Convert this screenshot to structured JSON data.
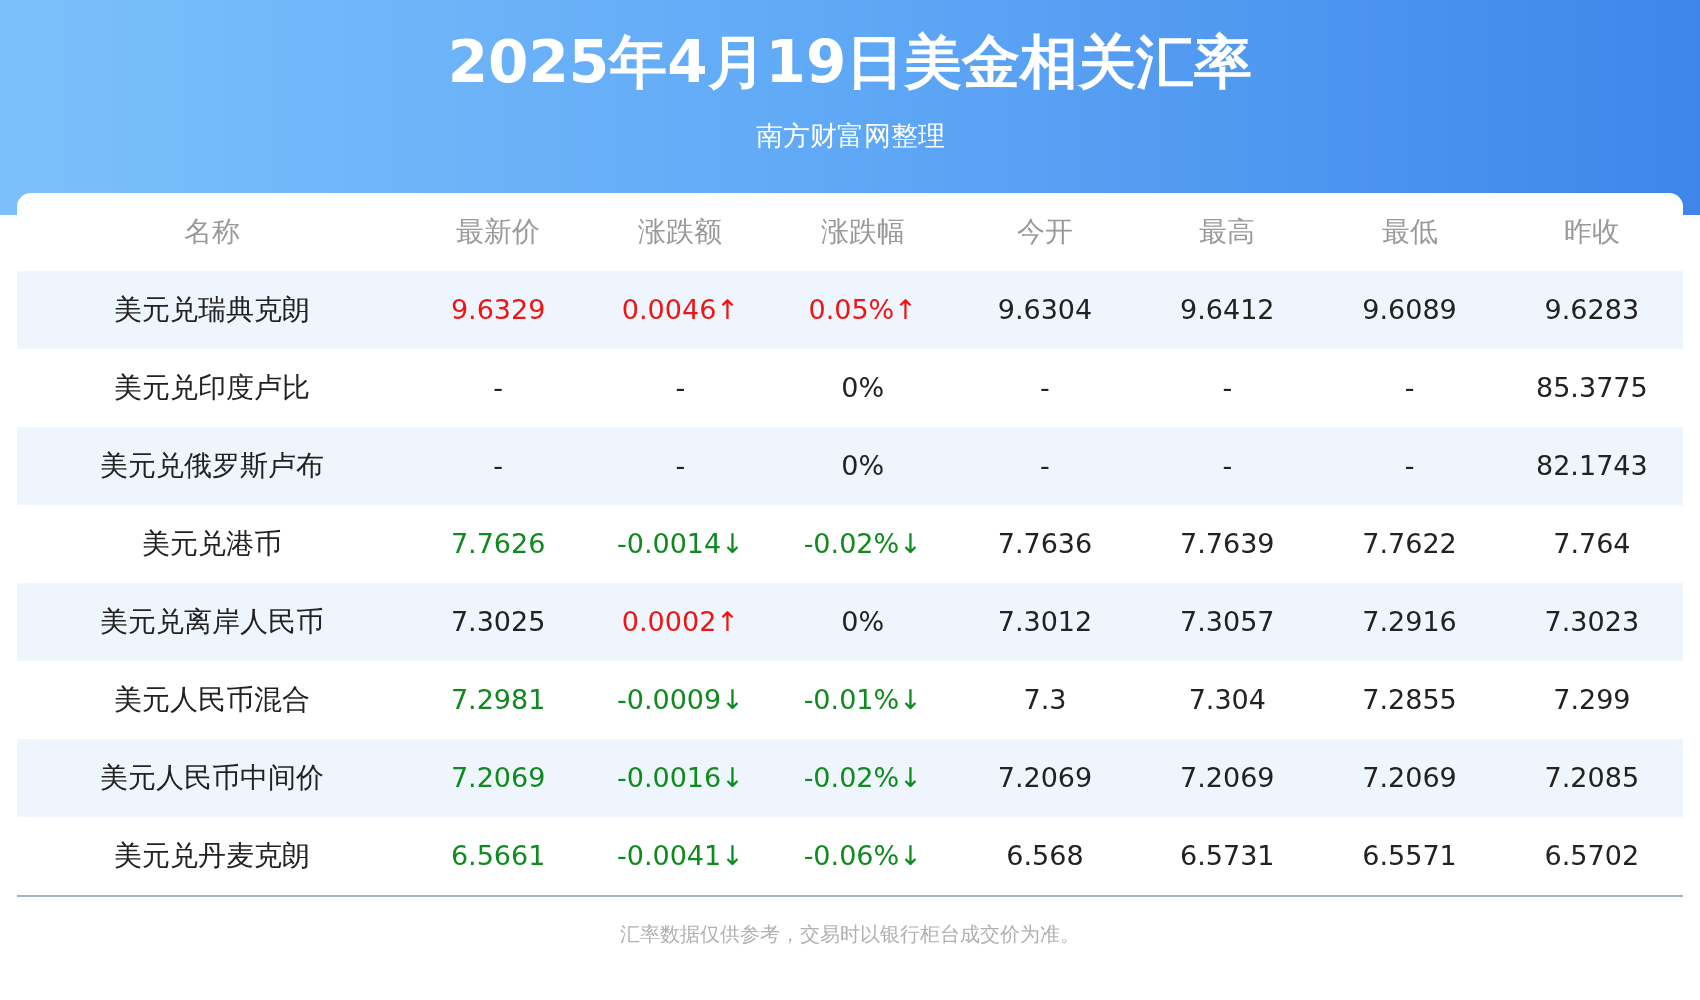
{
  "header": {
    "title": "2025年4月19日美金相关汇率",
    "subtitle": "南方财富网整理"
  },
  "table": {
    "columns": [
      "名称",
      "最新价",
      "涨跌额",
      "涨跌幅",
      "今开",
      "最高",
      "最低",
      "昨收"
    ],
    "rows": [
      {
        "cells": [
          {
            "text": "美元兑瑞典克朗",
            "color": "#222222"
          },
          {
            "text": "9.6329",
            "color": "#f01414"
          },
          {
            "text": "0.0046↑",
            "color": "#f01414"
          },
          {
            "text": "0.05%↑",
            "color": "#f01414"
          },
          {
            "text": "9.6304",
            "color": "#222222"
          },
          {
            "text": "9.6412",
            "color": "#222222"
          },
          {
            "text": "9.6089",
            "color": "#222222"
          },
          {
            "text": "9.6283",
            "color": "#222222"
          }
        ]
      },
      {
        "cells": [
          {
            "text": "美元兑印度卢比",
            "color": "#222222"
          },
          {
            "text": "-",
            "color": "#222222"
          },
          {
            "text": "-",
            "color": "#222222"
          },
          {
            "text": "0%",
            "color": "#222222"
          },
          {
            "text": "-",
            "color": "#222222"
          },
          {
            "text": "-",
            "color": "#222222"
          },
          {
            "text": "-",
            "color": "#222222"
          },
          {
            "text": "85.3775",
            "color": "#222222"
          }
        ]
      },
      {
        "cells": [
          {
            "text": "美元兑俄罗斯卢布",
            "color": "#222222"
          },
          {
            "text": "-",
            "color": "#222222"
          },
          {
            "text": "-",
            "color": "#222222"
          },
          {
            "text": "0%",
            "color": "#222222"
          },
          {
            "text": "-",
            "color": "#222222"
          },
          {
            "text": "-",
            "color": "#222222"
          },
          {
            "text": "-",
            "color": "#222222"
          },
          {
            "text": "82.1743",
            "color": "#222222"
          }
        ]
      },
      {
        "cells": [
          {
            "text": "美元兑港币",
            "color": "#222222"
          },
          {
            "text": "7.7626",
            "color": "#0f8a1e"
          },
          {
            "text": "-0.0014↓",
            "color": "#0f8a1e"
          },
          {
            "text": "-0.02%↓",
            "color": "#0f8a1e"
          },
          {
            "text": "7.7636",
            "color": "#222222"
          },
          {
            "text": "7.7639",
            "color": "#222222"
          },
          {
            "text": "7.7622",
            "color": "#222222"
          },
          {
            "text": "7.764",
            "color": "#222222"
          }
        ]
      },
      {
        "cells": [
          {
            "text": "美元兑离岸人民币",
            "color": "#222222"
          },
          {
            "text": "7.3025",
            "color": "#222222"
          },
          {
            "text": "0.0002↑",
            "color": "#f01414"
          },
          {
            "text": "0%",
            "color": "#222222"
          },
          {
            "text": "7.3012",
            "color": "#222222"
          },
          {
            "text": "7.3057",
            "color": "#222222"
          },
          {
            "text": "7.2916",
            "color": "#222222"
          },
          {
            "text": "7.3023",
            "color": "#222222"
          }
        ]
      },
      {
        "cells": [
          {
            "text": "美元人民币混合",
            "color": "#222222"
          },
          {
            "text": "7.2981",
            "color": "#0f8a1e"
          },
          {
            "text": "-0.0009↓",
            "color": "#0f8a1e"
          },
          {
            "text": "-0.01%↓",
            "color": "#0f8a1e"
          },
          {
            "text": "7.3",
            "color": "#222222"
          },
          {
            "text": "7.304",
            "color": "#222222"
          },
          {
            "text": "7.2855",
            "color": "#222222"
          },
          {
            "text": "7.299",
            "color": "#222222"
          }
        ]
      },
      {
        "cells": [
          {
            "text": "美元人民币中间价",
            "color": "#222222"
          },
          {
            "text": "7.2069",
            "color": "#0f8a1e"
          },
          {
            "text": "-0.0016↓",
            "color": "#0f8a1e"
          },
          {
            "text": "-0.02%↓",
            "color": "#0f8a1e"
          },
          {
            "text": "7.2069",
            "color": "#222222"
          },
          {
            "text": "7.2069",
            "color": "#222222"
          },
          {
            "text": "7.2069",
            "color": "#222222"
          },
          {
            "text": "7.2085",
            "color": "#222222"
          }
        ]
      },
      {
        "cells": [
          {
            "text": "美元兑丹麦克朗",
            "color": "#222222"
          },
          {
            "text": "6.5661",
            "color": "#0f8a1e"
          },
          {
            "text": "-0.0041↓",
            "color": "#0f8a1e"
          },
          {
            "text": "-0.06%↓",
            "color": "#0f8a1e"
          },
          {
            "text": "6.568",
            "color": "#222222"
          },
          {
            "text": "6.5731",
            "color": "#222222"
          },
          {
            "text": "6.5571",
            "color": "#222222"
          },
          {
            "text": "6.5702",
            "color": "#222222"
          }
        ]
      }
    ]
  },
  "footer": {
    "note": "汇率数据仅供参考，交易时以银行柜台成交价为准。"
  }
}
